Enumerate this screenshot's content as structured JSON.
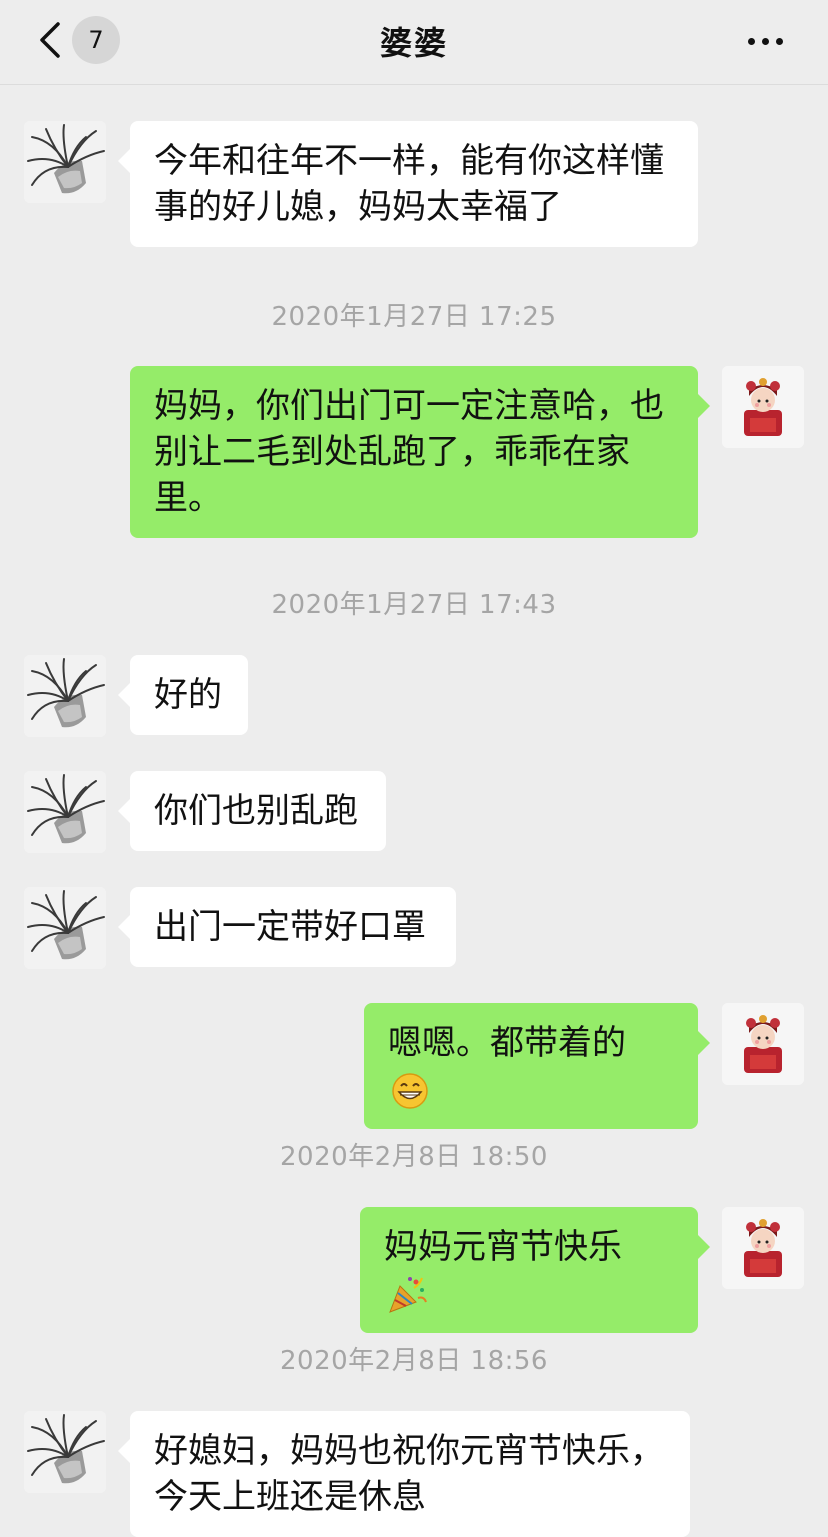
{
  "header": {
    "title": "婆婆",
    "unread_count": "7",
    "back_icon": "chevron-left-icon",
    "more_icon": "more-dots-icon"
  },
  "messages": [
    {
      "type": "msg",
      "side": "left",
      "text": "今年和往年不一样，能有你这样懂事的好儿媳，妈妈太幸福了"
    },
    {
      "type": "time",
      "text": "2020年1月27日 17:25"
    },
    {
      "type": "msg",
      "side": "right",
      "text": "妈妈，你们出门可一定注意哈，也别让二毛到处乱跑了，乖乖在家里。"
    },
    {
      "type": "time",
      "text": "2020年1月27日 17:43"
    },
    {
      "type": "msg",
      "side": "left",
      "text": "好的"
    },
    {
      "type": "msg",
      "side": "left",
      "text": "你们也别乱跑"
    },
    {
      "type": "msg",
      "side": "left",
      "text": "出门一定带好口罩"
    },
    {
      "type": "msg",
      "side": "right",
      "text": "嗯嗯。都带着的",
      "emoji": "grin-emoji"
    },
    {
      "type": "time",
      "text": "2020年2月8日 18:50"
    },
    {
      "type": "msg",
      "side": "right",
      "text": "妈妈元宵节快乐",
      "emoji": "party-popper-emoji"
    },
    {
      "type": "time",
      "text": "2020年2月8日 18:56"
    },
    {
      "type": "msg",
      "side": "left",
      "text": "好媳妇，妈妈也祝你元宵节快乐，今天上班还是休息"
    }
  ],
  "colors": {
    "background": "#ededed",
    "incoming_bubble": "#ffffff",
    "outgoing_bubble": "#95ec69",
    "timestamp": "#a5a5a5"
  }
}
